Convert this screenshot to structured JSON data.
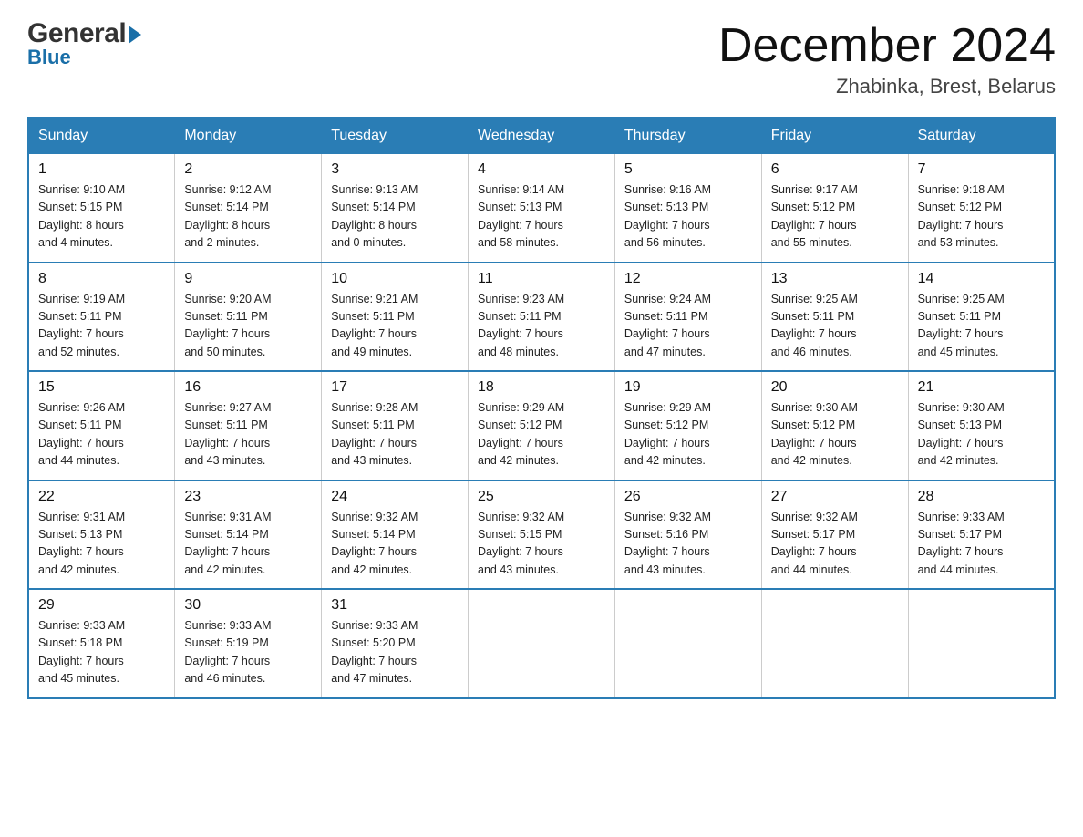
{
  "header": {
    "logo_general": "General",
    "logo_blue": "Blue",
    "month_year": "December 2024",
    "location": "Zhabinka, Brest, Belarus"
  },
  "days_of_week": [
    "Sunday",
    "Monday",
    "Tuesday",
    "Wednesday",
    "Thursday",
    "Friday",
    "Saturday"
  ],
  "weeks": [
    [
      {
        "day": "1",
        "sunrise": "9:10 AM",
        "sunset": "5:15 PM",
        "daylight": "8 hours and 4 minutes."
      },
      {
        "day": "2",
        "sunrise": "9:12 AM",
        "sunset": "5:14 PM",
        "daylight": "8 hours and 2 minutes."
      },
      {
        "day": "3",
        "sunrise": "9:13 AM",
        "sunset": "5:14 PM",
        "daylight": "8 hours and 0 minutes."
      },
      {
        "day": "4",
        "sunrise": "9:14 AM",
        "sunset": "5:13 PM",
        "daylight": "7 hours and 58 minutes."
      },
      {
        "day": "5",
        "sunrise": "9:16 AM",
        "sunset": "5:13 PM",
        "daylight": "7 hours and 56 minutes."
      },
      {
        "day": "6",
        "sunrise": "9:17 AM",
        "sunset": "5:12 PM",
        "daylight": "7 hours and 55 minutes."
      },
      {
        "day": "7",
        "sunrise": "9:18 AM",
        "sunset": "5:12 PM",
        "daylight": "7 hours and 53 minutes."
      }
    ],
    [
      {
        "day": "8",
        "sunrise": "9:19 AM",
        "sunset": "5:11 PM",
        "daylight": "7 hours and 52 minutes."
      },
      {
        "day": "9",
        "sunrise": "9:20 AM",
        "sunset": "5:11 PM",
        "daylight": "7 hours and 50 minutes."
      },
      {
        "day": "10",
        "sunrise": "9:21 AM",
        "sunset": "5:11 PM",
        "daylight": "7 hours and 49 minutes."
      },
      {
        "day": "11",
        "sunrise": "9:23 AM",
        "sunset": "5:11 PM",
        "daylight": "7 hours and 48 minutes."
      },
      {
        "day": "12",
        "sunrise": "9:24 AM",
        "sunset": "5:11 PM",
        "daylight": "7 hours and 47 minutes."
      },
      {
        "day": "13",
        "sunrise": "9:25 AM",
        "sunset": "5:11 PM",
        "daylight": "7 hours and 46 minutes."
      },
      {
        "day": "14",
        "sunrise": "9:25 AM",
        "sunset": "5:11 PM",
        "daylight": "7 hours and 45 minutes."
      }
    ],
    [
      {
        "day": "15",
        "sunrise": "9:26 AM",
        "sunset": "5:11 PM",
        "daylight": "7 hours and 44 minutes."
      },
      {
        "day": "16",
        "sunrise": "9:27 AM",
        "sunset": "5:11 PM",
        "daylight": "7 hours and 43 minutes."
      },
      {
        "day": "17",
        "sunrise": "9:28 AM",
        "sunset": "5:11 PM",
        "daylight": "7 hours and 43 minutes."
      },
      {
        "day": "18",
        "sunrise": "9:29 AM",
        "sunset": "5:12 PM",
        "daylight": "7 hours and 42 minutes."
      },
      {
        "day": "19",
        "sunrise": "9:29 AM",
        "sunset": "5:12 PM",
        "daylight": "7 hours and 42 minutes."
      },
      {
        "day": "20",
        "sunrise": "9:30 AM",
        "sunset": "5:12 PM",
        "daylight": "7 hours and 42 minutes."
      },
      {
        "day": "21",
        "sunrise": "9:30 AM",
        "sunset": "5:13 PM",
        "daylight": "7 hours and 42 minutes."
      }
    ],
    [
      {
        "day": "22",
        "sunrise": "9:31 AM",
        "sunset": "5:13 PM",
        "daylight": "7 hours and 42 minutes."
      },
      {
        "day": "23",
        "sunrise": "9:31 AM",
        "sunset": "5:14 PM",
        "daylight": "7 hours and 42 minutes."
      },
      {
        "day": "24",
        "sunrise": "9:32 AM",
        "sunset": "5:14 PM",
        "daylight": "7 hours and 42 minutes."
      },
      {
        "day": "25",
        "sunrise": "9:32 AM",
        "sunset": "5:15 PM",
        "daylight": "7 hours and 43 minutes."
      },
      {
        "day": "26",
        "sunrise": "9:32 AM",
        "sunset": "5:16 PM",
        "daylight": "7 hours and 43 minutes."
      },
      {
        "day": "27",
        "sunrise": "9:32 AM",
        "sunset": "5:17 PM",
        "daylight": "7 hours and 44 minutes."
      },
      {
        "day": "28",
        "sunrise": "9:33 AM",
        "sunset": "5:17 PM",
        "daylight": "7 hours and 44 minutes."
      }
    ],
    [
      {
        "day": "29",
        "sunrise": "9:33 AM",
        "sunset": "5:18 PM",
        "daylight": "7 hours and 45 minutes."
      },
      {
        "day": "30",
        "sunrise": "9:33 AM",
        "sunset": "5:19 PM",
        "daylight": "7 hours and 46 minutes."
      },
      {
        "day": "31",
        "sunrise": "9:33 AM",
        "sunset": "5:20 PM",
        "daylight": "7 hours and 47 minutes."
      },
      null,
      null,
      null,
      null
    ]
  ],
  "labels": {
    "sunrise": "Sunrise:",
    "sunset": "Sunset:",
    "daylight": "Daylight:"
  }
}
